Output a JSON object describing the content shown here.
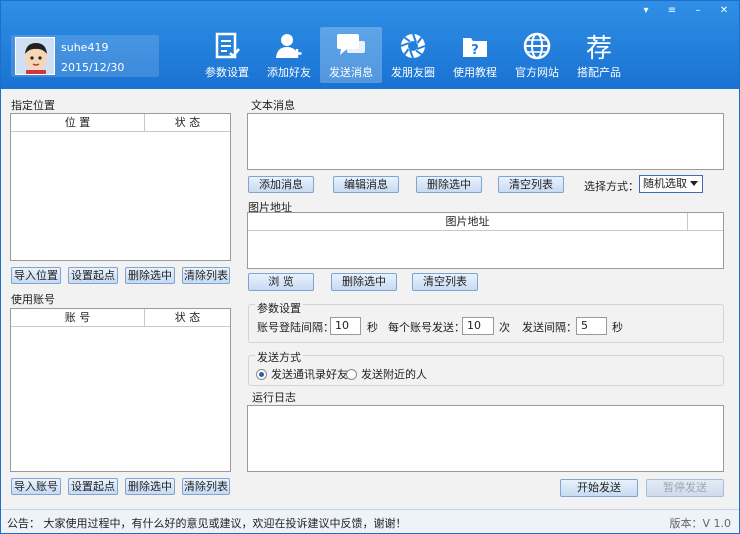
{
  "window": {
    "controls": [
      "▾",
      "≡",
      "–",
      "✕"
    ]
  },
  "user": {
    "name": "suhe419",
    "date": "2015/12/30"
  },
  "nav": {
    "items": [
      {
        "label": "参数设置",
        "icon": "settings-doc-icon"
      },
      {
        "label": "添加好友",
        "icon": "add-friend-icon"
      },
      {
        "label": "发送消息",
        "icon": "message-bubble-icon"
      },
      {
        "label": "发朋友圈",
        "icon": "aperture-icon"
      },
      {
        "label": "使用教程",
        "icon": "help-folder-icon"
      },
      {
        "label": "官方网站",
        "icon": "globe-icon"
      },
      {
        "label": "搭配产品",
        "icon": "recommend-icon",
        "glyph": "荐"
      }
    ],
    "active_index": 2
  },
  "left": {
    "location_section": {
      "title": "指定位置",
      "columns": [
        "位 置",
        "状 态"
      ],
      "buttons": [
        "导入位置",
        "设置起点",
        "删除选中",
        "清除列表"
      ]
    },
    "account_section": {
      "title": "使用账号",
      "columns": [
        "账 号",
        "状 态"
      ],
      "buttons": [
        "导入账号",
        "设置起点",
        "删除选中",
        "清除列表"
      ]
    }
  },
  "right": {
    "text_message": {
      "title": "文本消息",
      "buttons": [
        "添加消息",
        "编辑消息",
        "删除选中",
        "清空列表"
      ],
      "select_label": "选择方式：",
      "select_value": "随机选取"
    },
    "image_address": {
      "title": "图片地址",
      "columns": [
        "图片地址"
      ],
      "buttons": [
        "浏 览",
        "删除选中",
        "清空列表"
      ]
    },
    "params": {
      "title": "参数设置",
      "login_interval_label": "账号登陆间隔：",
      "login_interval_value": "10",
      "unit_sec": "秒",
      "per_account_label": "每个账号发送：",
      "per_account_value": "10",
      "unit_times": "次",
      "send_interval_label": "发送间隔：",
      "send_interval_value": "5"
    },
    "send_mode": {
      "title": "发送方式",
      "options": [
        "发送通讯录好友",
        "发送附近的人"
      ],
      "selected_index": 0
    },
    "log": {
      "title": "运行日志"
    },
    "actions": {
      "start": "开始发送",
      "pause": "暂停发送"
    }
  },
  "footer": {
    "notice": "公告： 大家使用过程中，有什么好的意见或建议，欢迎在投诉建议中反馈，谢谢！",
    "version": "版本：V 1.0"
  },
  "colors": {
    "header": "#1f7fdc",
    "accent": "#2b5fa8"
  }
}
